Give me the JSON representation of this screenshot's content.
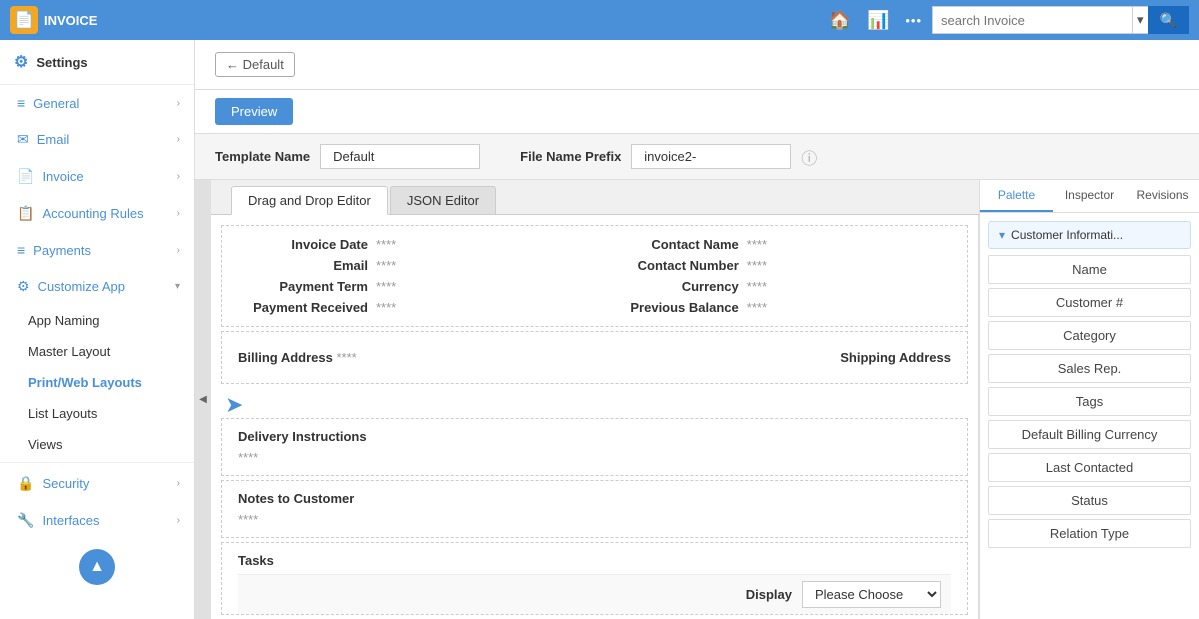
{
  "topbar": {
    "app_name": "INVOICE",
    "search_placeholder": "search Invoice",
    "home_icon": "🏠",
    "chart_icon": "📊",
    "more_icon": "•••",
    "search_icon": "🔍"
  },
  "sidebar": {
    "settings_label": "Settings",
    "items": [
      {
        "id": "general",
        "label": "General",
        "icon": "≡"
      },
      {
        "id": "email",
        "label": "Email",
        "icon": "✉"
      },
      {
        "id": "invoice",
        "label": "Invoice",
        "icon": "📄"
      },
      {
        "id": "accounting-rules",
        "label": "Accounting Rules",
        "icon": "📋"
      },
      {
        "id": "payments",
        "label": "Payments",
        "icon": "≡"
      },
      {
        "id": "customize-app",
        "label": "Customize App",
        "icon": "⚙"
      }
    ],
    "customize_sub_items": [
      {
        "id": "app-naming",
        "label": "App Naming"
      },
      {
        "id": "master-layout",
        "label": "Master Layout"
      },
      {
        "id": "print-web-layouts",
        "label": "Print/Web Layouts"
      },
      {
        "id": "list-layouts",
        "label": "List Layouts"
      },
      {
        "id": "views",
        "label": "Views"
      }
    ],
    "bottom_items": [
      {
        "id": "security",
        "label": "Security",
        "icon": "🔒"
      },
      {
        "id": "interfaces",
        "label": "Interfaces",
        "icon": "🔧"
      }
    ],
    "up_label": "▲"
  },
  "header": {
    "back_label": "← Default",
    "preview_label": "Preview"
  },
  "template": {
    "name_label": "Template Name",
    "name_value": "Default",
    "prefix_label": "File Name Prefix",
    "prefix_value": "invoice2-"
  },
  "editor": {
    "tabs": [
      {
        "id": "drag-drop",
        "label": "Drag and Drop Editor",
        "active": true
      },
      {
        "id": "json",
        "label": "JSON Editor",
        "active": false
      }
    ]
  },
  "canvas": {
    "row1": [
      {
        "label": "Invoice Date",
        "value": "****"
      },
      {
        "label": "Contact Name",
        "value": "****"
      }
    ],
    "row2": [
      {
        "label": "Email",
        "value": "****"
      },
      {
        "label": "Contact Number",
        "value": "****"
      }
    ],
    "row3": [
      {
        "label": "Payment Term",
        "value": "****"
      },
      {
        "label": "Currency",
        "value": "****"
      }
    ],
    "row4": [
      {
        "label": "Payment Received",
        "value": "****"
      },
      {
        "label": "Previous Balance",
        "value": "****"
      }
    ],
    "billing_label": "Billing Address",
    "billing_value": "****",
    "shipping_label": "Shipping Address",
    "delivery_title": "Delivery Instructions",
    "delivery_value": "****",
    "notes_title": "Notes to Customer",
    "notes_value": "****",
    "tasks_title": "Tasks",
    "display_label": "Display",
    "display_value": "Please Choose"
  },
  "palette": {
    "tabs": [
      {
        "id": "palette",
        "label": "Palette",
        "active": true
      },
      {
        "id": "inspector",
        "label": "Inspector",
        "active": false
      },
      {
        "id": "revisions",
        "label": "Revisions",
        "active": false
      }
    ],
    "section_title": "Customer Informati...",
    "items": [
      {
        "id": "name",
        "label": "Name"
      },
      {
        "id": "customer-num",
        "label": "Customer #"
      },
      {
        "id": "category",
        "label": "Category"
      },
      {
        "id": "sales-rep",
        "label": "Sales Rep."
      },
      {
        "id": "tags",
        "label": "Tags"
      },
      {
        "id": "default-billing-currency",
        "label": "Default Billing Currency"
      },
      {
        "id": "last-contacted",
        "label": "Last Contacted"
      },
      {
        "id": "status",
        "label": "Status"
      },
      {
        "id": "relation-type",
        "label": "Relation Type"
      }
    ]
  }
}
